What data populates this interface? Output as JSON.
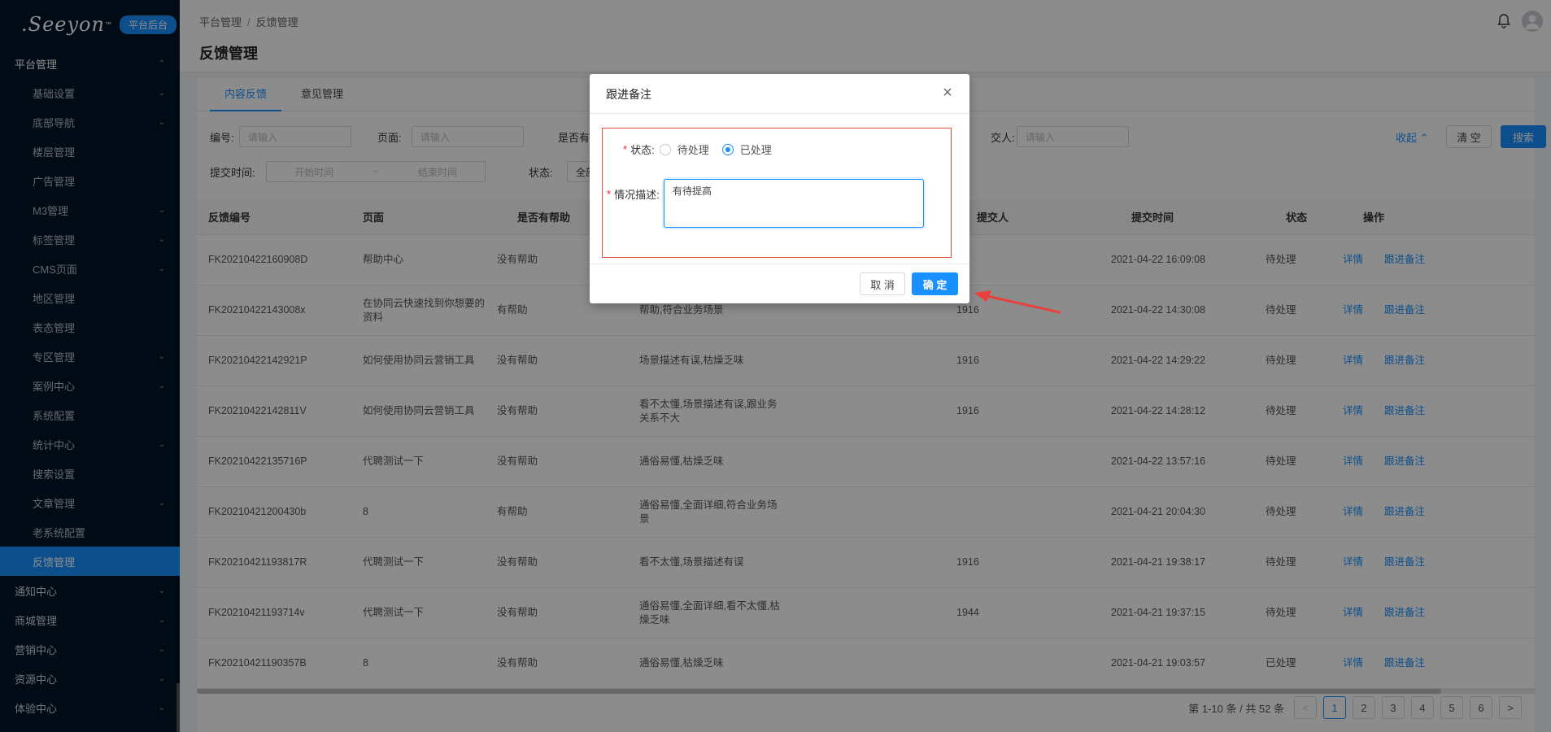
{
  "sidebar": {
    "logo": ".Seeyon",
    "logo_tm": "™",
    "badge": "平台后台",
    "group_title": "平台管理",
    "sub_items": [
      {
        "label": "基础设置",
        "chev": true
      },
      {
        "label": "底部导航",
        "chev": true
      },
      {
        "label": "楼层管理",
        "chev": false
      },
      {
        "label": "广告管理",
        "chev": false
      },
      {
        "label": "M3管理",
        "chev": true
      },
      {
        "label": "标签管理",
        "chev": true
      },
      {
        "label": "CMS页面",
        "chev": true
      },
      {
        "label": "地区管理",
        "chev": false
      },
      {
        "label": "表态管理",
        "chev": false
      },
      {
        "label": "专区管理",
        "chev": true
      },
      {
        "label": "案例中心",
        "chev": true
      },
      {
        "label": "系统配置",
        "chev": false
      },
      {
        "label": "统计中心",
        "chev": true
      },
      {
        "label": "搜索设置",
        "chev": false
      },
      {
        "label": "文章管理",
        "chev": true
      },
      {
        "label": "老系统配置",
        "chev": false
      },
      {
        "label": "反馈管理",
        "chev": false,
        "active": true
      }
    ],
    "groups": [
      "通知中心",
      "商城管理",
      "营销中心",
      "资源中心",
      "体验中心"
    ]
  },
  "header": {
    "breadcrumb": [
      "平台管理",
      "反馈管理"
    ],
    "breadcrumb_sep": "/",
    "title": "反馈管理"
  },
  "tabs": [
    "内容反馈",
    "意见管理"
  ],
  "filters": {
    "id_label": "编号:",
    "id_placeholder": "请输入",
    "page_label": "页面:",
    "page_placeholder": "请输入",
    "helpful_label": "是否有",
    "submitter_label": "交人:",
    "submitter_placeholder": "请输入",
    "collapse": "收起",
    "clear": "清 空",
    "search": "搜索",
    "time_label": "提交时间:",
    "time_start": "开始时间",
    "time_sep": "~",
    "time_end": "结束时间",
    "status_label": "状态:",
    "status_value": "全部"
  },
  "table": {
    "columns": [
      "反馈编号",
      "页面",
      "是否有帮助",
      "",
      "提交人",
      "提交时间",
      "状态",
      "操作"
    ],
    "action_detail": "详情",
    "action_note": "跟进备注",
    "rows": [
      {
        "id": "FK20210422160908D",
        "page": "帮助中心",
        "helpful": "没有帮助",
        "desc": "",
        "user": "",
        "time": "2021-04-22 16:09:08",
        "status": "待处理"
      },
      {
        "id": "FK20210422143008x",
        "page": "在协同云快速找到你想要的资料",
        "helpful": "有帮助",
        "desc": "帮助,符合业务场景",
        "user": "1916",
        "time": "2021-04-22 14:30:08",
        "status": "待处理"
      },
      {
        "id": "FK20210422142921P",
        "page": "如何使用协同云营销工具",
        "helpful": "没有帮助",
        "desc": "场景描述有误,枯燥乏味",
        "user": "1916",
        "time": "2021-04-22 14:29:22",
        "status": "待处理"
      },
      {
        "id": "FK20210422142811V",
        "page": "如何使用协同云营销工具",
        "helpful": "没有帮助",
        "desc": "看不太懂,场景描述有误,跟业务关系不大",
        "user": "1916",
        "time": "2021-04-22 14:28:12",
        "status": "待处理"
      },
      {
        "id": "FK20210422135716P",
        "page": "代聘测试一下",
        "helpful": "没有帮助",
        "desc": "通俗易懂,枯燥乏味",
        "user": "",
        "time": "2021-04-22 13:57:16",
        "status": "待处理"
      },
      {
        "id": "FK20210421200430b",
        "page": "8",
        "helpful": "有帮助",
        "desc": "通俗易懂,全面详细,符合业务场景",
        "user": "",
        "time": "2021-04-21 20:04:30",
        "status": "待处理"
      },
      {
        "id": "FK20210421193817R",
        "page": "代聘测试一下",
        "helpful": "没有帮助",
        "desc": "看不太懂,场景描述有误",
        "user": "1916",
        "time": "2021-04-21 19:38:17",
        "status": "待处理"
      },
      {
        "id": "FK20210421193714v",
        "page": "代聘测试一下",
        "helpful": "没有帮助",
        "desc": "通俗易懂,全面详细,看不太懂,枯燥乏味",
        "user": "1944",
        "time": "2021-04-21 19:37:15",
        "status": "待处理"
      },
      {
        "id": "FK20210421190357B",
        "page": "8",
        "helpful": "没有帮助",
        "desc": "通俗易懂,枯燥乏味",
        "user": "",
        "time": "2021-04-21 19:03:57",
        "status": "已处理"
      }
    ]
  },
  "pagination": {
    "summary": "第 1-10 条 / 共 52 条",
    "prev": "<",
    "next": ">",
    "pages": [
      "1",
      "2",
      "3",
      "4",
      "5",
      "6"
    ],
    "current": "1"
  },
  "modal": {
    "title": "跟进备注",
    "close": "×",
    "status_label": "状态:",
    "option_pending": "待处理",
    "option_done": "已处理",
    "selected": "已处理",
    "desc_label": "情况描述:",
    "required_mark": "*",
    "desc_value": "有待提高",
    "cancel": "取 消",
    "confirm": "确 定"
  },
  "colors": {
    "primary": "#1890ff",
    "sidebar_bg": "#001529",
    "highlight_box": "#e84c3d",
    "arrow": "#e8403c"
  }
}
